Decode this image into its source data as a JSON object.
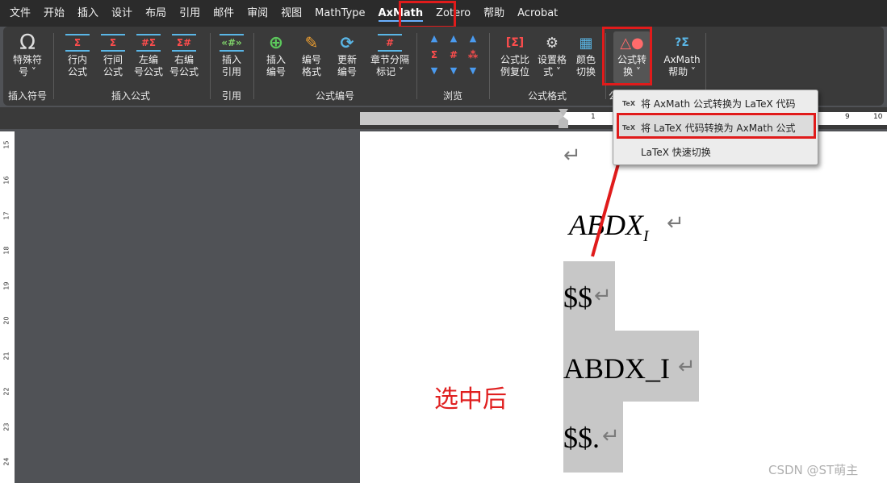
{
  "menubar": {
    "items": [
      "文件",
      "开始",
      "插入",
      "设计",
      "布局",
      "引用",
      "邮件",
      "审阅",
      "视图",
      "MathType",
      "AxMath",
      "Zotero",
      "帮助",
      "Acrobat"
    ],
    "active": "AxMath"
  },
  "ribbon": {
    "groups": {
      "insert_symbol": {
        "label": "插入符号",
        "special_char": "特殊符\n号 ˅"
      },
      "insert_formula": {
        "label": "插入公式",
        "inline": "行内\n公式",
        "display": "行间\n公式",
        "left_num": "左编\n号公式",
        "right_num": "右编\n号公式"
      },
      "cite": {
        "label": "引用",
        "insert_cite": "插入\n引用"
      },
      "numbering": {
        "label": "公式编号",
        "insert_num": "插入\n编号",
        "num_format": "编号\n格式",
        "update_num": "更新\n编号",
        "chapter_sep": "章节分隔\n标记 ˅"
      },
      "browse": {
        "label": "浏览"
      },
      "format": {
        "label": "公式格式",
        "ratio_reset": "公式比\n例复位",
        "set_format": "设置格\n式 ˅",
        "color_switch": "颜色\n切换"
      },
      "convert": {
        "label": "公",
        "convert_btn": "公式转\n换 ˅"
      },
      "help": {
        "help_btn": "AxMath\n帮助 ˅"
      }
    }
  },
  "ruler": {
    "numbers": [
      "1",
      "9",
      "10"
    ],
    "vertical": [
      "15",
      "16",
      "17",
      "18",
      "19",
      "20",
      "21",
      "22",
      "23",
      "24"
    ]
  },
  "dropdown": {
    "items": [
      {
        "icon": "TeX",
        "label": "将 AxMath 公式转换为 LaTeX 代码"
      },
      {
        "icon": "TeX",
        "label": "将 LaTeX 代码转换为 AxMath 公式"
      },
      {
        "icon": "",
        "label": "LaTeX 快速切换"
      }
    ]
  },
  "document": {
    "para_mark": "↵",
    "formula_main": "ABDX",
    "formula_sub": "I",
    "line1": "$$",
    "line2": "ABDX_I",
    "line3": "$$."
  },
  "annotation": "选中后",
  "watermark": "CSDN @ST萌主",
  "colors": {
    "accent_red": "#e01b1b",
    "sigma_red": "#ff4d4d",
    "ribbon_blue": "#5ab6e6"
  }
}
